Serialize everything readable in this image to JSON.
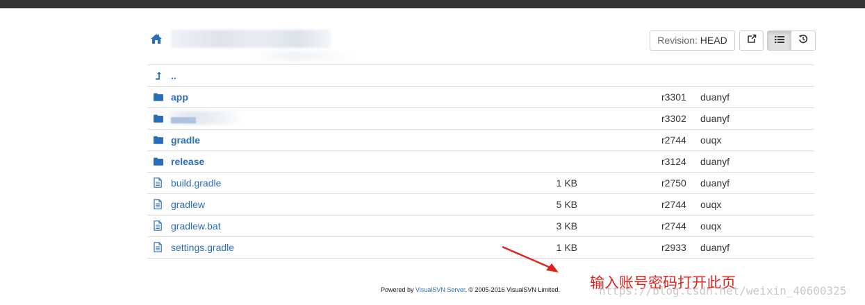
{
  "header": {
    "revision_prefix": "Revision:",
    "revision_value": "HEAD"
  },
  "up_link": "..",
  "rows": [
    {
      "name": "app",
      "type": "dir",
      "size": "",
      "rev": "r3301",
      "author": "duanyf"
    },
    {
      "name": "",
      "type": "dir",
      "size": "",
      "rev": "r3302",
      "author": "duanyf",
      "obscured": true
    },
    {
      "name": "gradle",
      "type": "dir",
      "size": "",
      "rev": "r2744",
      "author": "ouqx"
    },
    {
      "name": "release",
      "type": "dir",
      "size": "",
      "rev": "r3124",
      "author": "duanyf"
    },
    {
      "name": "build.gradle",
      "type": "file",
      "size": "1 KB",
      "rev": "r2750",
      "author": "duanyf"
    },
    {
      "name": "gradlew",
      "type": "file",
      "size": "5 KB",
      "rev": "r2744",
      "author": "ouqx"
    },
    {
      "name": "gradlew.bat",
      "type": "file",
      "size": "3 KB",
      "rev": "r2744",
      "author": "ouqx"
    },
    {
      "name": "settings.gradle",
      "type": "file",
      "size": "1 KB",
      "rev": "r2933",
      "author": "duanyf"
    }
  ],
  "footer": {
    "prefix": "Powered by ",
    "link": "VisualSVN Server",
    "suffix": ". © 2005-2016 VisualSVN Limited."
  },
  "annotation": "输入账号密码打开此页",
  "watermark": "https://blog.csdn.net/weixin_40600325",
  "colors": {
    "link": "#2a6ebb",
    "annotation": "#e0211c",
    "topbar": "#333333"
  },
  "icons": {
    "home": "home-icon",
    "up": "level-up-icon",
    "dir": "folder-icon",
    "file": "file-text-icon",
    "external": "external-link-icon",
    "list": "list-icon",
    "history": "history-icon"
  }
}
